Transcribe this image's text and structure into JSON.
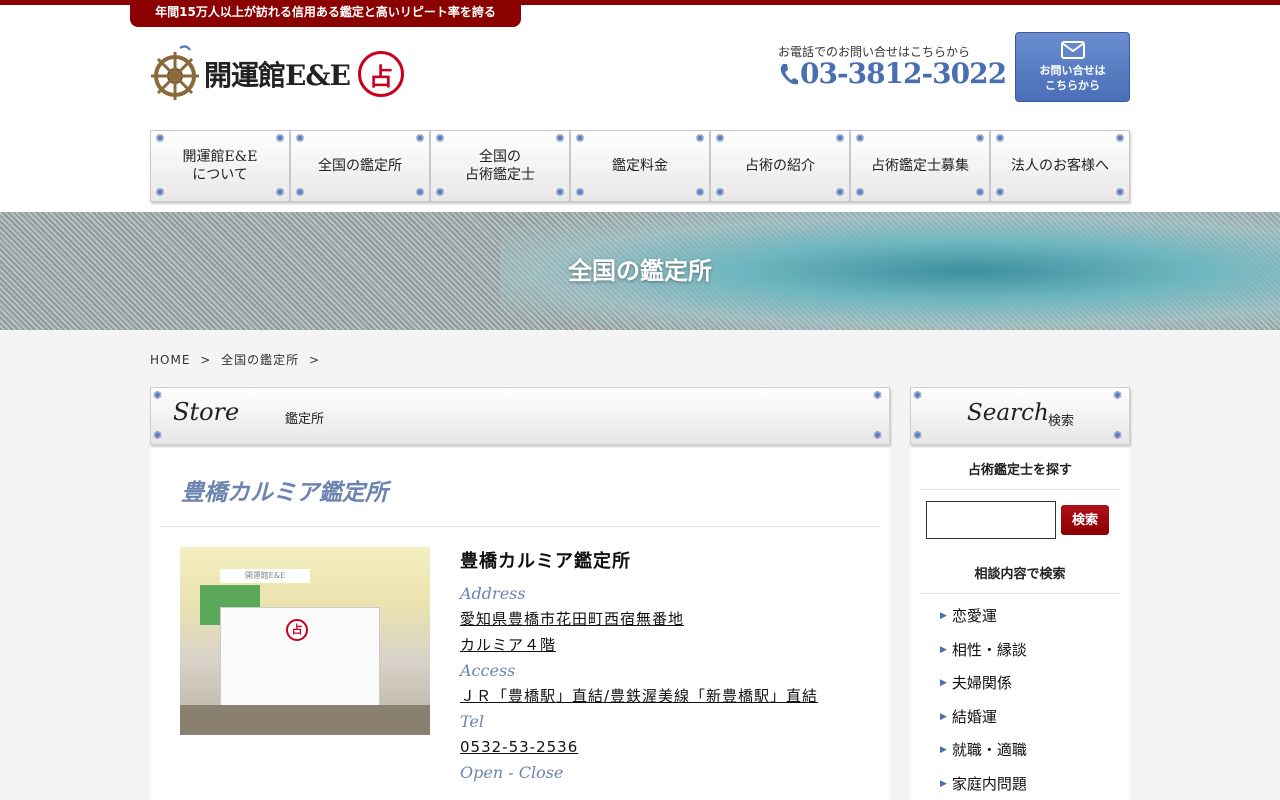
{
  "header": {
    "tagline": "年間15万人以上が訪れる信用ある鑑定と高いリピート率を誇る",
    "logo_text": "開運館E&E",
    "logo_seal": "占",
    "phone_caption": "お電話でのお問い合せはこちらから",
    "phone_number": "03-3812-3022",
    "contact_line1": "お問い合せは",
    "contact_line2": "こちらから"
  },
  "nav": {
    "items": [
      {
        "line1": "開運館E&E",
        "line2": "について"
      },
      {
        "line1": "全国の鑑定所",
        "line2": ""
      },
      {
        "line1": "全国の",
        "line2": "占術鑑定士"
      },
      {
        "line1": "鑑定料金",
        "line2": ""
      },
      {
        "line1": "占術の紹介",
        "line2": ""
      },
      {
        "line1": "占術鑑定士募集",
        "line2": ""
      },
      {
        "line1": "法人のお客様へ",
        "line2": ""
      }
    ]
  },
  "hero": {
    "title": "全国の鑑定所"
  },
  "breadcrumb": {
    "home": "HOME",
    "sep": ">",
    "current": "全国の鑑定所"
  },
  "main": {
    "section_en": "Store",
    "section_jp": "鑑定所",
    "store_title": "豊橋カルミア鑑定所",
    "photo_sign": "開運館E&E",
    "photo_seal": "占",
    "store_name": "豊橋カルミア鑑定所",
    "address_label": "Address",
    "address_line1": "愛知県豊橋市花田町西宿無番地",
    "address_line2": "カルミア４階",
    "access_label": "Access",
    "access_value": "ＪＲ「豊橋駅」直結/豊鉄渥美線「新豊橋駅」直結",
    "tel_label": "Tel",
    "tel_value": "0532-53-2536",
    "hours_label": "Open - Close"
  },
  "sidebar": {
    "section_en": "Search",
    "section_jp": "検索",
    "find_label": "占術鑑定士を探す",
    "search_placeholder": "",
    "search_button": "検索",
    "category_label": "相談内容で検索",
    "categories": [
      "恋愛運",
      "相性・縁談",
      "夫婦関係",
      "結婚運",
      "就職・適職",
      "家庭内問題"
    ]
  },
  "colors": {
    "brand_red": "#8b0000",
    "accent_blue": "#4a6fb0",
    "title_blue": "#6b84b0"
  }
}
